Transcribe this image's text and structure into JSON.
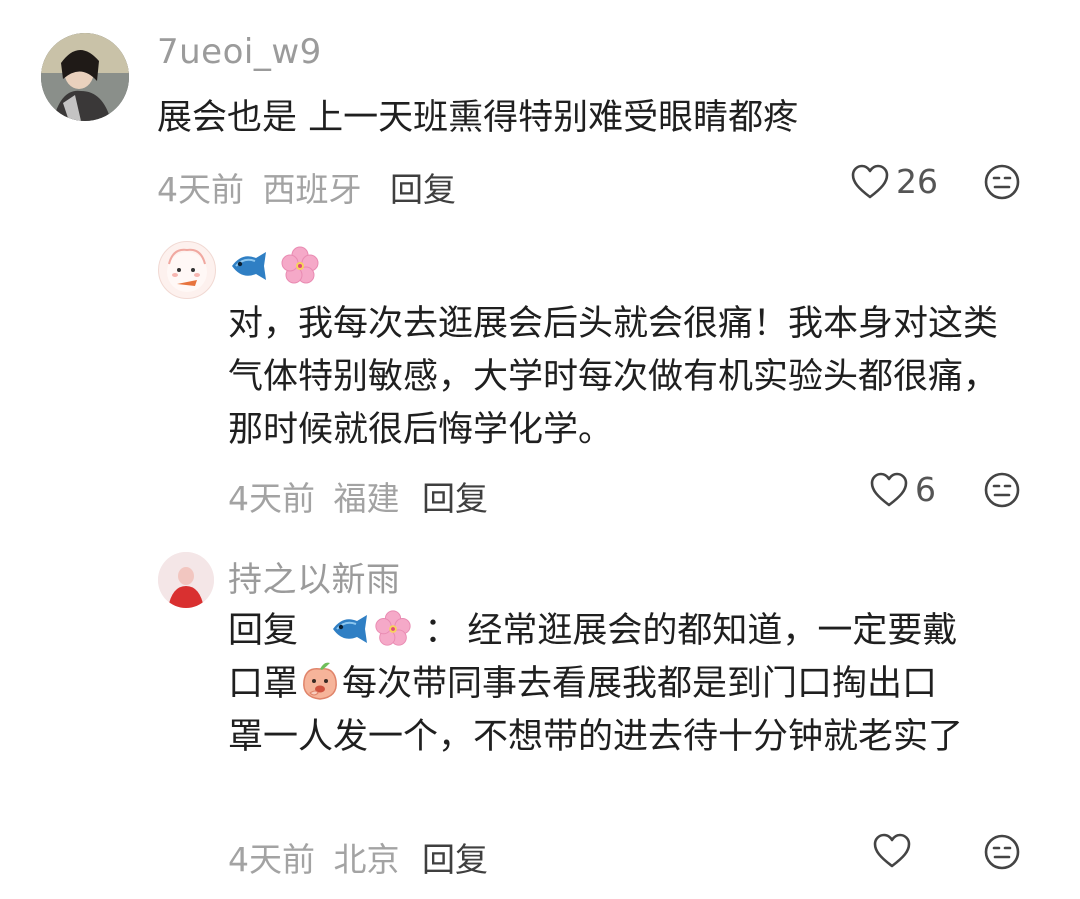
{
  "comments": [
    {
      "username": "7ueoi_w9",
      "text": "展会也是 上一天班熏得特别难受眼睛都疼",
      "time": "4天前",
      "location": "西班牙",
      "reply_label": "回复",
      "likes": "26"
    },
    {
      "username_icons": [
        "fish-icon",
        "cherry-blossom-icon"
      ],
      "text": "对，我每次去逛展会后头就会很痛！我本身对这类气体特别敏感，大学时每次做有机实验头都很痛，那时候就很后悔学化学。",
      "time": "4天前",
      "location": "福建",
      "reply_label": "回复",
      "likes": "6"
    },
    {
      "username": "持之以新雨",
      "reply_prefix": "回复",
      "reply_suffix": "：",
      "text_part1": "经常逛展会的都知道，一定要戴",
      "text_line2a": "口罩",
      "text_line2b": "每次带同事去看展我都是到门口掏出口",
      "text_rest": "罩一人发一个，不想带的进去待十分钟就老实了",
      "time": "4天前",
      "location": "北京",
      "reply_label": "回复",
      "likes": ""
    }
  ],
  "colors": {
    "meta": "#a3a3a3",
    "username": "#9b9b9b",
    "fish": "#2f7fc4",
    "blossom": "#f5a9c8"
  }
}
